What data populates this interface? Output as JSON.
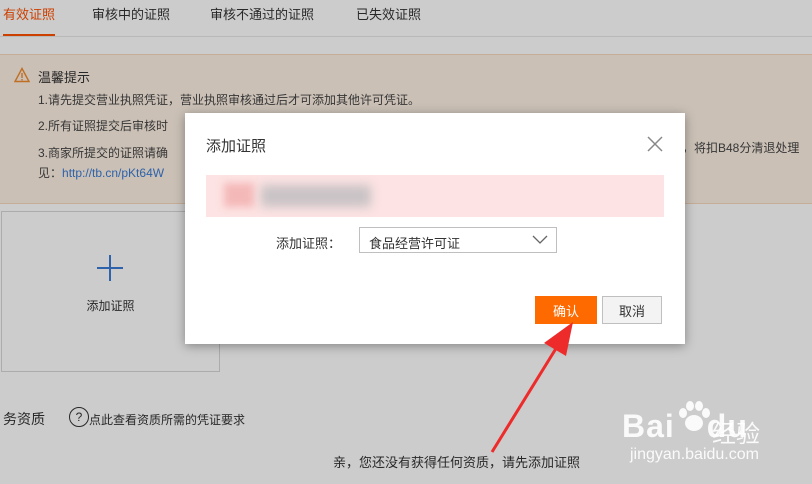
{
  "tabs": [
    {
      "label": "有效证照",
      "active": true
    },
    {
      "label": "审核中的证照",
      "active": false
    },
    {
      "label": "审核不通过的证照",
      "active": false
    },
    {
      "label": "已失效证照",
      "active": false
    }
  ],
  "notice": {
    "title": "温馨提示",
    "line1": "1.请先提交营业执照凭证，营业执照审核通过后才可添加其他许可凭证。",
    "line2": "2.所有证照提交后审核时",
    "line3": "3.商家所提交的证照请确",
    "line3_tail": "，将扣B48分清退处理",
    "line4_prefix": "见：",
    "link": "http://tb.cn/pKt64W"
  },
  "add_card": {
    "label": "添加证照"
  },
  "section": {
    "title": "务资质",
    "help_icon": "?",
    "help_text": "点此查看资质所需的凭证要求"
  },
  "empty_text": "亲，您还没有获得任何资质，请先添加证照",
  "modal": {
    "title": "添加证照",
    "field_label": "添加证照：",
    "select_value": "食品经营许可证",
    "confirm_label": "确认",
    "cancel_label": "取消"
  },
  "watermark": {
    "logo": "Bai",
    "logo2": "du",
    "sub": "经验",
    "url": "jingyan.baidu.com"
  },
  "colors": {
    "accent": "#ff5000",
    "confirm": "#ff6a00",
    "arrow": "#ee2b2b",
    "link": "#3a7bd5"
  },
  "icons": [
    "warning-icon",
    "plus-icon",
    "help-icon",
    "close-icon",
    "chevron-down-icon",
    "arrow-annotation"
  ]
}
